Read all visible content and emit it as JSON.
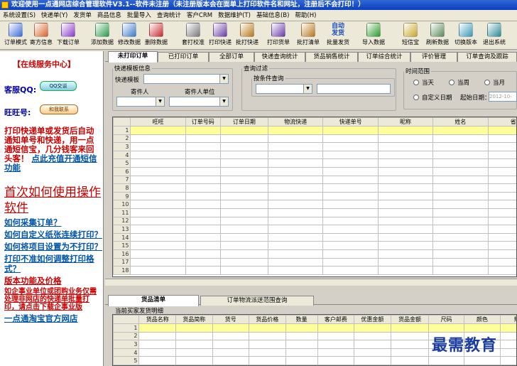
{
  "window": {
    "title": "欢迎使用一点通网店综合管理软件V3.1--软件未注册（未注册版本会在面单上打印软件名和网址，注册后不会打印！）"
  },
  "menu": [
    "系统设置(S)",
    "快递单(Y)",
    "发货单",
    "商品信息",
    "批量导入",
    "查询统计",
    "客户CRM",
    "数据维护(T)",
    "基础信息(B)",
    "帮助(H)"
  ],
  "toolbar": [
    {
      "label": "订单模式",
      "color": "#3a6ed8"
    },
    {
      "label": "寄方信息",
      "color": "#d8642a"
    },
    {
      "label": "下载订单",
      "color": "#8a3ac8"
    },
    {
      "label": "添加数据",
      "color": "#2a9a4a"
    },
    {
      "label": "修改数据",
      "color": "#3a7ac8"
    },
    {
      "label": "删除数据",
      "color": "#c82a2a"
    },
    {
      "label": "套打校准",
      "color": "#7a7a7a"
    },
    {
      "label": "打印快递",
      "color": "#6a3aa8"
    },
    {
      "label": "批打快递",
      "color": "#b8781a"
    },
    {
      "label": "打印货单",
      "color": "#6a3aa8"
    },
    {
      "label": "批打清单",
      "color": "#b8781a"
    },
    {
      "label": "批量发货",
      "color": "#2a6ac8"
    },
    {
      "label": "导入数据",
      "color": "#2a9a2a"
    },
    {
      "label": "短信宝",
      "color": "#c8a82a"
    },
    {
      "label": "刷新数据",
      "color": "#5a8a5a"
    },
    {
      "label": "切换版本",
      "color": "#3a9ab8"
    },
    {
      "label": "退出系统",
      "color": "#2a8a9a"
    }
  ],
  "toolbar_extra": {
    "auto_ship": "自动\n发货"
  },
  "sidebar": {
    "service_title": "【在线服务中心】",
    "qq_label": "客服QQ:",
    "qq_button": "QQ交谈",
    "ww_label": "旺旺号:",
    "ww_button": "和我联系",
    "promo": "打印快递单或发货后自动通知单号和快递，用一点通短信宝，几分钱客来回头客！",
    "promo_link": "点此充值开通短信功能",
    "big_link": "首次如何使用操作软件",
    "links": [
      "如何采集订单？",
      "如何自定义纸张连续打印？",
      "如何将项目设置为不打印？",
      "打印不准如何调整打印格式？"
    ],
    "feature_title": "版本功能及价格",
    "feature_text": "如企事业单位或团购业务仅需处理非网店的快递单批量打印，请点击下载企事业版",
    "shop_link": "一点通淘宝官方网店"
  },
  "tabs": [
    "未打印订单",
    "已打印订单",
    "全部订单",
    "快递查询统计",
    "货品销售统计",
    "订单综合统计",
    "评价管理",
    "订单查询及跟踪"
  ],
  "filters": {
    "template_group": "快递模板信息",
    "template_label": "快递模板",
    "sender_label": "寄件人",
    "sender_unit_label": "寄件人单位",
    "query_group": "查询过滤",
    "condition_select": "按条件查询",
    "time_group": "时间范围",
    "radios": [
      "当天",
      "当周",
      "当月",
      "自定义日期"
    ],
    "start_date_label": "起始日期：",
    "start_date_value": "2012-10-"
  },
  "orders_table": {
    "columns": [
      "旺旺",
      "订单号码",
      "订单日期",
      "物流快递",
      "快递单号",
      "昵称",
      "姓名",
      "省"
    ],
    "rows": [
      "1",
      "2",
      "3",
      "4",
      "5",
      "6",
      "7",
      "8",
      "9",
      "10",
      "11",
      "12",
      "13",
      "14",
      "15",
      "16",
      "17",
      "18"
    ]
  },
  "bottom_tabs": [
    "货品清单",
    "订单物流派送范围查询"
  ],
  "items_caption": "当前买家发货明细",
  "items_table": {
    "columns": [
      "货品名称",
      "货品简称",
      "货号",
      "货品价格",
      "数量",
      "客户邮费",
      "优惠金额",
      "货品金额",
      "尺码",
      "颜色",
      "规格"
    ],
    "rows": [
      "1",
      "2",
      "3",
      "4",
      "5"
    ]
  },
  "watermark": "最需教育"
}
